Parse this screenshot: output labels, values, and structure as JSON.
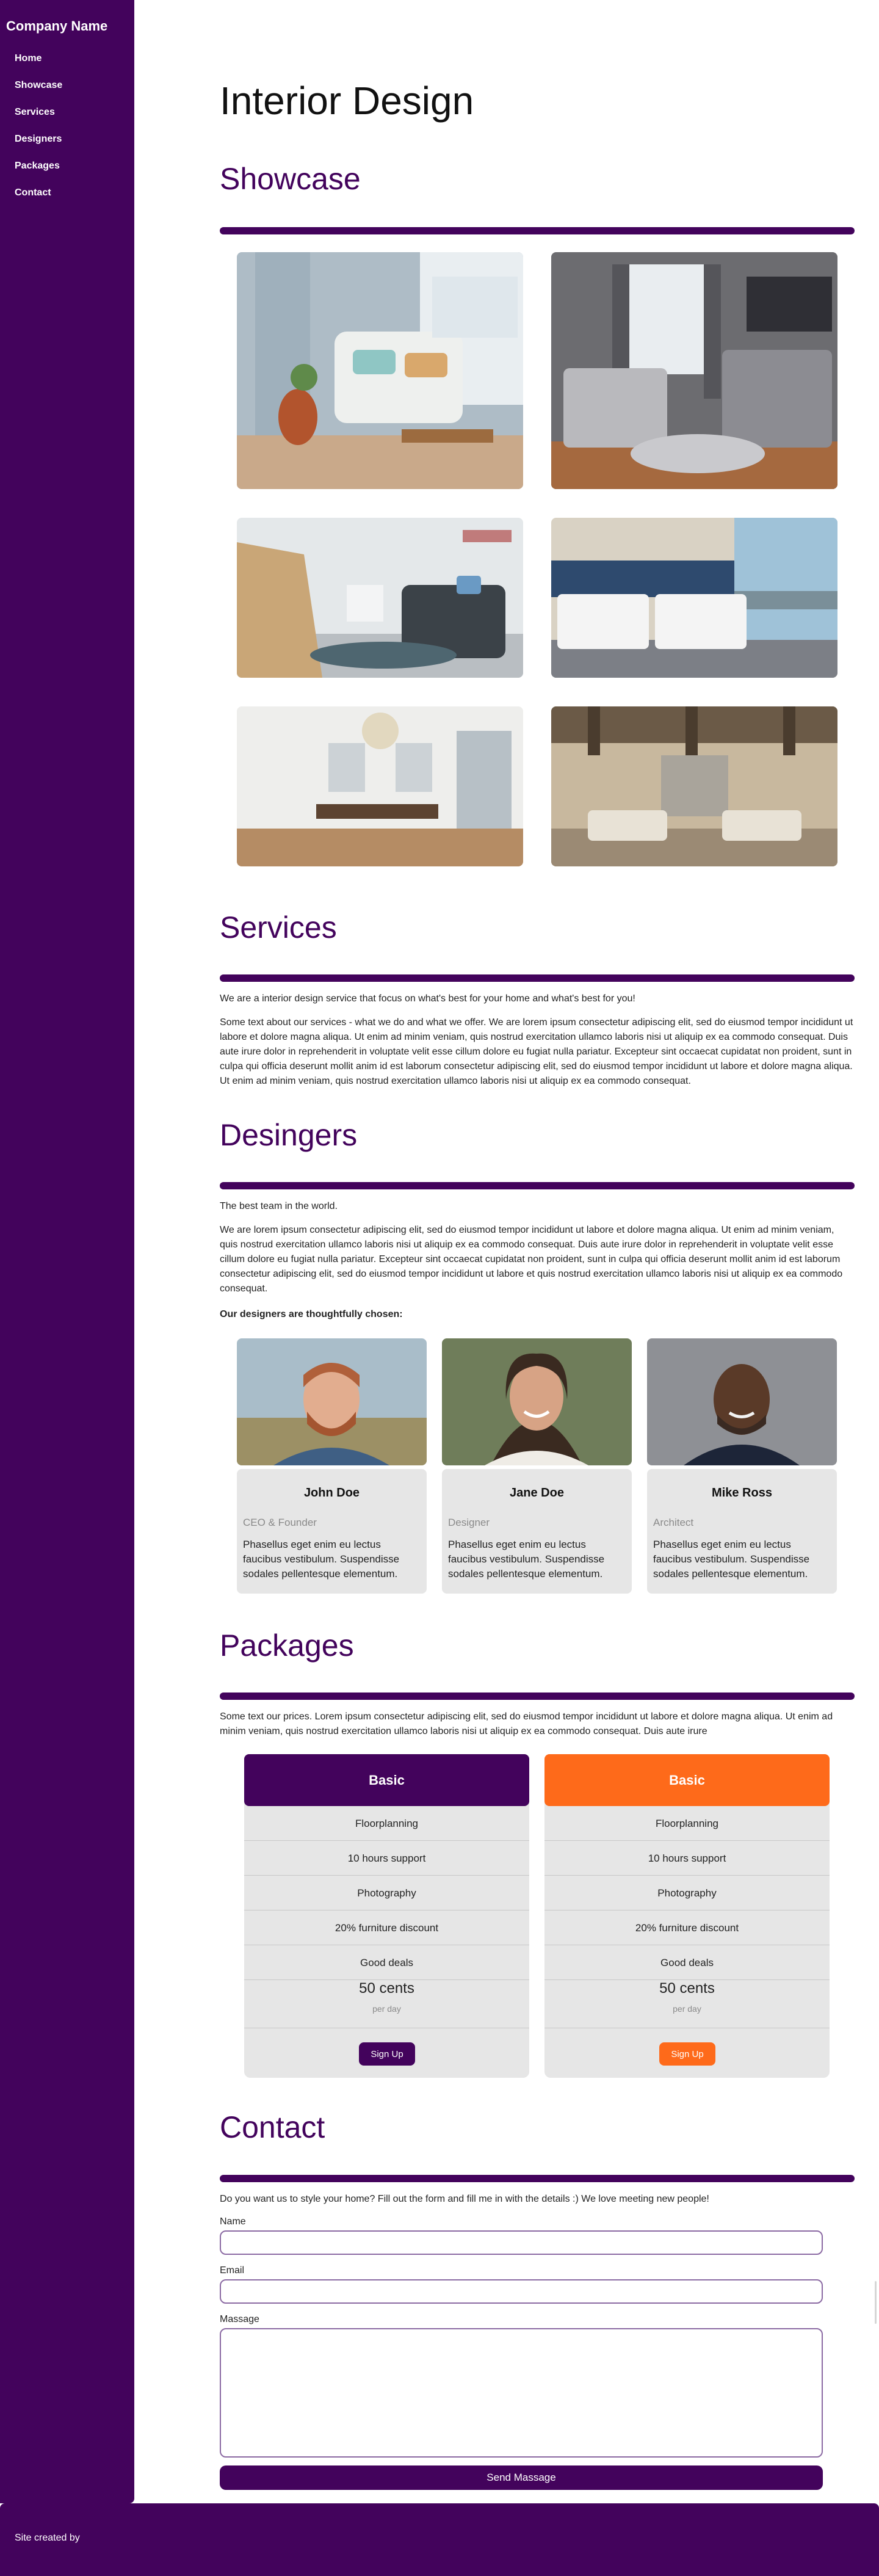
{
  "sidebar": {
    "brand": "Company Name",
    "nav": [
      "Home",
      "Showcase",
      "Services",
      "Designers",
      "Packages",
      "Contact"
    ]
  },
  "header": {
    "title": "Interior Design"
  },
  "showcase": {
    "title": "Showcase",
    "images": [
      "living-room-photo",
      "bedroom-photo",
      "lounge-chair-photo",
      "hotel-room-photo",
      "dining-room-photo",
      "great-room-photo"
    ]
  },
  "services": {
    "title": "Services",
    "intro": "We are a interior design service that focus on what's best for your home and what's best for you!",
    "body": "Some text about our services - what we do and what we offer. We are lorem ipsum consectetur adipiscing elit, sed do eiusmod tempor incididunt ut labore et dolore magna aliqua. Ut enim ad minim veniam, quis nostrud exercitation ullamco laboris nisi ut aliquip ex ea commodo consequat. Duis aute irure dolor in reprehenderit in voluptate velit esse cillum dolore eu fugiat nulla pariatur. Excepteur sint occaecat cupidatat non proident, sunt in culpa qui officia deserunt mollit anim id est laborum consectetur adipiscing elit, sed do eiusmod tempor incididunt ut labore et dolore magna aliqua. Ut enim ad minim veniam, quis nostrud exercitation ullamco laboris nisi ut aliquip ex ea commodo consequat."
  },
  "designers": {
    "title": "Desingers",
    "intro": "The best team in the world.",
    "body": "We are lorem ipsum consectetur adipiscing elit, sed do eiusmod tempor incididunt ut labore et dolore magna aliqua. Ut enim ad minim veniam, quis nostrud exercitation ullamco laboris nisi ut aliquip ex ea commodo consequat. Duis aute irure dolor in reprehenderit in voluptate velit esse cillum dolore eu fugiat nulla pariatur. Excepteur sint occaecat cupidatat non proident, sunt in culpa qui officia deserunt mollit anim id est laborum consectetur adipiscing elit, sed do eiusmod tempor incididunt ut labore et quis nostrud exercitation ullamco laboris nisi ut aliquip ex ea commodo consequat.",
    "chosen": "Our designers are thoughtfully chosen:",
    "people": [
      {
        "name": "John Doe",
        "role": "CEO & Founder",
        "bio": "Phasellus eget enim eu lectus faucibus vestibulum. Suspendisse sodales pellentesque elementum."
      },
      {
        "name": "Jane Doe",
        "role": "Designer",
        "bio": "Phasellus eget enim eu lectus faucibus vestibulum. Suspendisse sodales pellentesque elementum."
      },
      {
        "name": "Mike Ross",
        "role": "Architect",
        "bio": "Phasellus eget enim eu lectus faucibus vestibulum. Suspendisse sodales pellentesque elementum."
      }
    ]
  },
  "packages": {
    "title": "Packages",
    "intro": "Some text our prices. Lorem ipsum consectetur adipiscing elit, sed do eiusmod tempor incididunt ut labore et dolore magna aliqua. Ut enim ad minim veniam, quis nostrud exercitation ullamco laboris nisi ut aliquip ex ea commodo consequat. Duis aute irure",
    "plans": [
      {
        "name": "Basic",
        "color": "#43035c",
        "features": [
          "Floorplanning",
          "10 hours support",
          "Photography",
          "20% furniture discount",
          "Good deals"
        ],
        "price": "50 cents",
        "per": "per day",
        "button": "Sign Up"
      },
      {
        "name": "Basic",
        "color": "#fe6a1a",
        "features": [
          "Floorplanning",
          "10 hours support",
          "Photography",
          "20% furniture discount",
          "Good deals"
        ],
        "price": "50 cents",
        "per": "per day",
        "button": "Sign Up"
      }
    ]
  },
  "contact": {
    "title": "Contact",
    "intro": "Do you want us to style your home? Fill out the form and fill me in with the details :) We love meeting new people!",
    "name_label": "Name",
    "email_label": "Email",
    "message_label": "Massage",
    "send": "Send Massage"
  },
  "footer": {
    "text": "Site created by"
  },
  "colors": {
    "accent": "#43035c",
    "orange": "#fe6a1a",
    "card": "#e6e6e6"
  }
}
